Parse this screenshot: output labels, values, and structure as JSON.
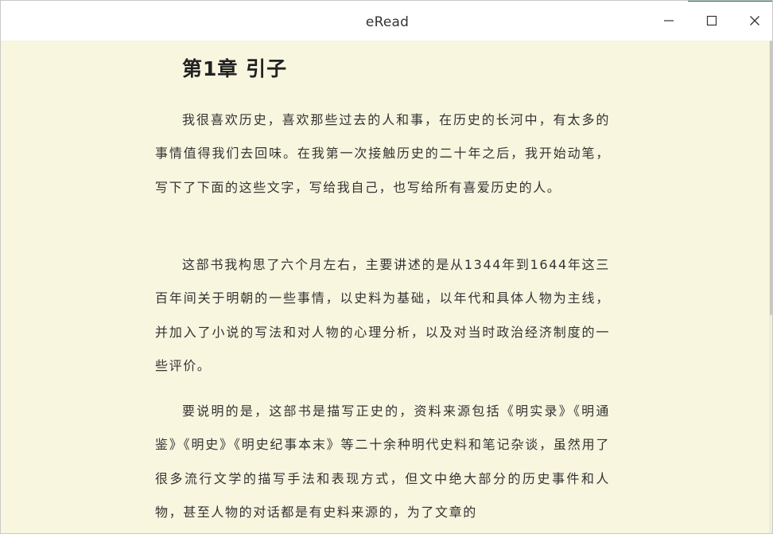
{
  "window": {
    "title": "eRead",
    "controls": {
      "minimize_icon": "minimize-icon",
      "maximize_icon": "maximize-icon",
      "close_icon": "close-icon"
    }
  },
  "colors": {
    "page_background": "#f8f6df",
    "text": "#333333",
    "heading": "#222222",
    "titlebar": "#ffffff",
    "accent": "#1f7a4c"
  },
  "reader": {
    "chapter_title": "第1章 引子",
    "paragraphs": [
      "我很喜欢历史，喜欢那些过去的人和事，在历史的长河中，有太多的事情值得我们去回味。在我第一次接触历史的二十年之后，我开始动笔，写下了下面的这些文字，写给我自己，也写给所有喜爱历史的人。",
      "这部书我构思了六个月左右，主要讲述的是从1344年到1644年这三百年间关于明朝的一些事情，以史料为基础，以年代和具体人物为主线，并加入了小说的写法和对人物的心理分析，以及对当时政治经济制度的一些评价。",
      "要说明的是，这部书是描写正史的，资料来源包括《明实录》《明通鉴》《明史》《明史纪事本末》等二十余种明代史料和笔记杂谈，虽然用了很多流行文学的描写手法和表现方式，但文中绝大部分的历史事件和人物，甚至人物的对话都是有史料来源的，为了文章的"
    ]
  }
}
